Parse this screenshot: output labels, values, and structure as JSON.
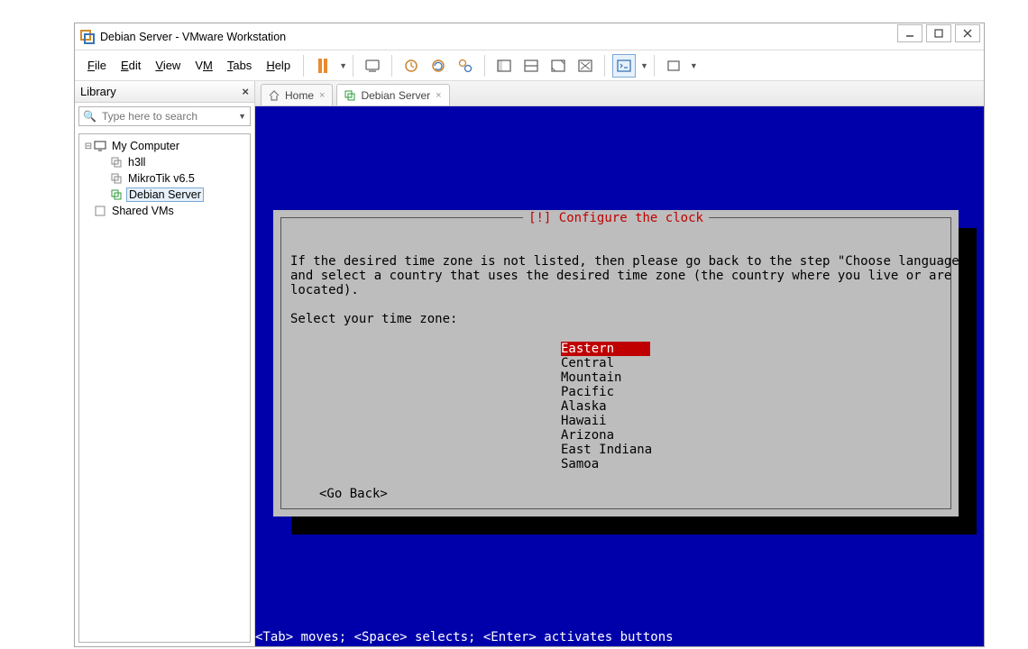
{
  "window": {
    "title": "Debian Server - VMware Workstation"
  },
  "menus": {
    "file": "File",
    "edit": "Edit",
    "view": "View",
    "vm": "VM",
    "tabs": "Tabs",
    "help": "Help"
  },
  "library": {
    "title": "Library",
    "search_placeholder": "Type here to search",
    "root": "My Computer",
    "vm1": "h3ll",
    "vm2": "MikroTik v6.5",
    "vm3": "Debian Server",
    "shared": "Shared VMs"
  },
  "tabs": {
    "home": "Home",
    "active": "Debian Server"
  },
  "installer": {
    "title": "[!] Configure the clock",
    "help1": "If the desired time zone is not listed, then please go back to the step \"Choose language\"",
    "help2": "and select a country that uses the desired time zone (the country where you live or are",
    "help3": "located).",
    "prompt": "Select your time zone:",
    "options": [
      "Eastern",
      "Central",
      "Mountain",
      "Pacific",
      "Alaska",
      "Hawaii",
      "Arizona",
      "East Indiana",
      "Samoa"
    ],
    "selected_index": 0,
    "goback": "<Go Back>",
    "status": "<Tab> moves; <Space> selects; <Enter> activates buttons"
  }
}
